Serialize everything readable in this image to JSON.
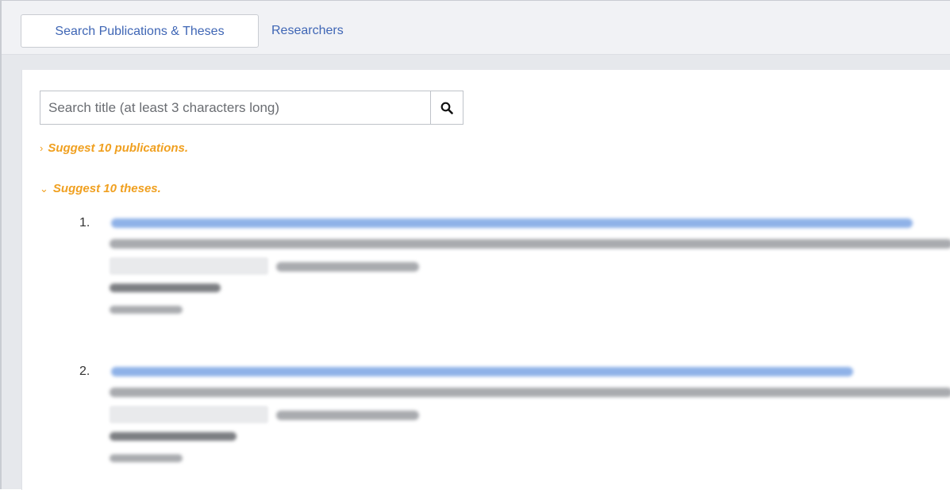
{
  "tabs": [
    {
      "label": "Search Publications & Theses",
      "active": true
    },
    {
      "label": "Researchers",
      "active": false
    }
  ],
  "search": {
    "placeholder": "Search title (at least 3 characters long)",
    "value": "",
    "button_icon": "search-icon"
  },
  "suggestions": {
    "publications": {
      "label": "Suggest 10 publications.",
      "expanded": false,
      "icon": "chevron-right-icon"
    },
    "theses": {
      "label": "Suggest 10 theses.",
      "expanded": true,
      "icon": "chevron-down-icon"
    }
  },
  "theses_list": [
    {
      "number": "1."
    },
    {
      "number": "2."
    }
  ],
  "colors": {
    "accent_link": "#3f66b5",
    "suggest_orange": "#f0a020",
    "blurred_title": "#8fb2e8"
  }
}
